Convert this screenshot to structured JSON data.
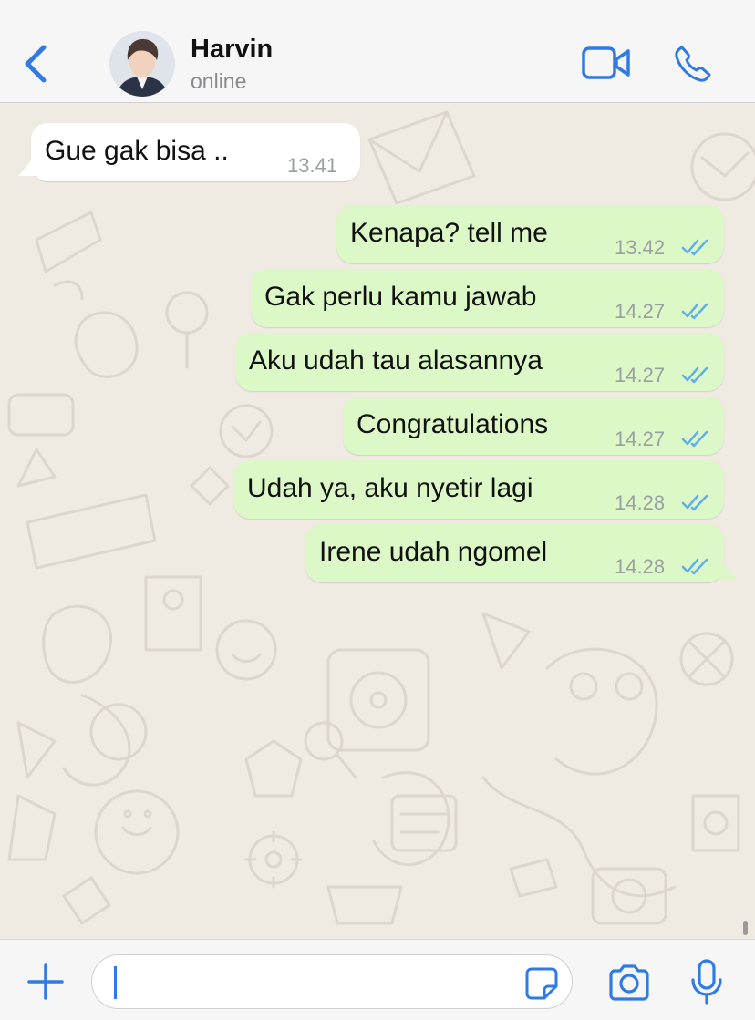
{
  "header": {
    "contact_name": "Harvin",
    "status": "online",
    "icons": {
      "back": "chevron-left-icon",
      "video": "video-camera-icon",
      "call": "phone-icon"
    }
  },
  "messages": [
    {
      "direction": "incoming",
      "text": "Gue gak bisa ..",
      "time": "13.41"
    },
    {
      "direction": "outgoing",
      "text": "Kenapa? tell me",
      "time": "13.42",
      "read": true
    },
    {
      "direction": "outgoing",
      "text": "Gak perlu kamu jawab",
      "time": "14.27",
      "read": true
    },
    {
      "direction": "outgoing",
      "text": "Aku udah tau alasannya",
      "time": "14.27",
      "read": true
    },
    {
      "direction": "outgoing",
      "text": "Congratulations",
      "time": "14.27",
      "read": true
    },
    {
      "direction": "outgoing",
      "text": "Udah ya, aku nyetir lagi",
      "time": "14.28",
      "read": true
    },
    {
      "direction": "outgoing",
      "text": "Irene udah ngomel",
      "time": "14.28",
      "read": true
    }
  ],
  "input_bar": {
    "message_value": "",
    "icons": {
      "add": "plus-icon",
      "sticker": "sticker-icon",
      "camera": "camera-icon",
      "mic": "microphone-icon"
    }
  },
  "colors": {
    "accent": "#2f7ae5",
    "outgoing_bubble": "#dcf8c6",
    "incoming_bubble": "#ffffff",
    "chat_background": "#efeae2",
    "read_ticks": "#5eaef0"
  }
}
